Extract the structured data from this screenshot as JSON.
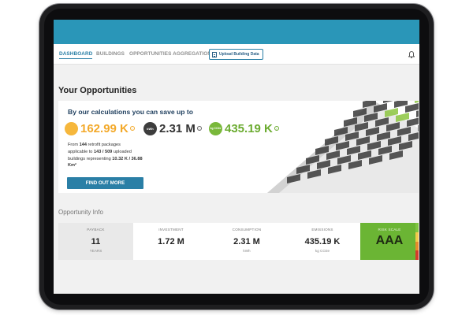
{
  "nav": {
    "items": [
      "DASHBOARD",
      "BUILDINGS",
      "OPPORTUNITIES AGGREGATION"
    ],
    "upload_label": "Upload Building Data",
    "icons": {
      "upload": "document-icon",
      "notifications": "bell-icon"
    }
  },
  "page": {
    "title": "Your Opportunities"
  },
  "savings": {
    "headline": "By our calculations you can save up to",
    "metrics": [
      {
        "badge": "",
        "value": "162.99 K",
        "color": "#f6b73c",
        "icon": "currency-coin-icon"
      },
      {
        "badge": "kWh",
        "value": "2.31 M",
        "color": "#3d3d3d",
        "icon": "kwh-icon"
      },
      {
        "badge": "kg CO2e",
        "value": "435.19 K",
        "color": "#79b83a",
        "icon": "co2-icon"
      }
    ],
    "description": {
      "line1_pre": "From ",
      "packages": "144",
      "line1_post": " retrofit packages",
      "line2_pre": "applicable to ",
      "buildings": "143 / 509",
      "line2_post": " uploaded",
      "line3_pre": "buildings representing ",
      "area": "10.32 K / 36.88",
      "unit": "Km²"
    },
    "cta_label": "FIND OUT MORE"
  },
  "opportunity_info": {
    "title": "Opportunity Info",
    "columns": [
      {
        "label": "PAYBACK",
        "value": "11",
        "unit": "YEARS"
      },
      {
        "label": "INVESTMENT",
        "value": "1.72 M",
        "unit": ""
      },
      {
        "label": "CONSUMPTION",
        "value": "2.31 M",
        "unit": "kWh"
      },
      {
        "label": "EMISSIONS",
        "value": "435.19 K",
        "unit": "kg CO2e"
      },
      {
        "label": "RISK SCALE",
        "value": "AAA",
        "unit": ""
      }
    ],
    "risk_colors": [
      "#7fc540",
      "#f2c84b",
      "#e88b2c",
      "#d63b2b"
    ]
  },
  "colors": {
    "header": "#2a96b8",
    "accent": "#2a7fa6"
  }
}
